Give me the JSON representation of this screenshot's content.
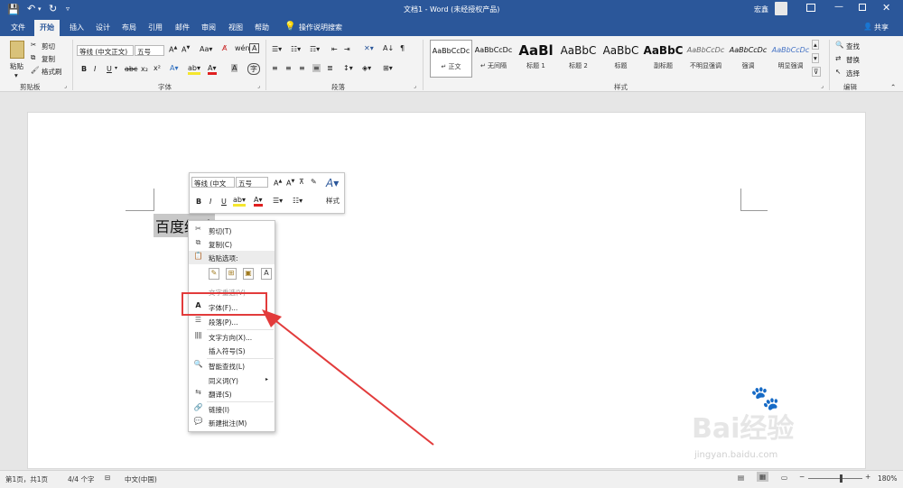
{
  "title_bar": {
    "title": "文档1 - Word (未经授权产品)",
    "user": "宏鑫"
  },
  "tabs": [
    "文件",
    "开始",
    "插入",
    "设计",
    "布局",
    "引用",
    "邮件",
    "审阅",
    "视图",
    "帮助"
  ],
  "tell_me": "操作说明搜索",
  "share": "共享",
  "clipboard": {
    "paste": "粘贴",
    "cut": "剪切",
    "copy": "复制",
    "format_painter": "格式刷",
    "group": "剪贴板"
  },
  "font_group": {
    "font_name": "等线 (中文正文)",
    "font_size": "五号",
    "group": "字体"
  },
  "paragraph_group": {
    "group": "段落"
  },
  "styles": {
    "group": "样式",
    "items": [
      {
        "preview": "AaBbCcDc",
        "label": "↵ 正文"
      },
      {
        "preview": "AaBbCcDc",
        "label": "↵ 无间隔"
      },
      {
        "preview": "AaBl",
        "label": "标题 1"
      },
      {
        "preview": "AaBbC",
        "label": "标题 2"
      },
      {
        "preview": "AaBbC",
        "label": "标题"
      },
      {
        "preview": "AaBbC",
        "label": "副标题"
      },
      {
        "preview": "AaBbCcDc",
        "label": "不明显强调"
      },
      {
        "preview": "AaBbCcDc",
        "label": "强调"
      },
      {
        "preview": "AaBbCcDc",
        "label": "明显强调"
      }
    ]
  },
  "editing": {
    "find": "查找",
    "replace": "替换",
    "select": "选择",
    "group": "编辑"
  },
  "mini_toolbar": {
    "font": "等线 (中文",
    "size": "五号",
    "styles": "样式"
  },
  "doc_text": "百度经验",
  "context_menu": {
    "cut": "剪切(T)",
    "copy": "复制(C)",
    "paste_options": "粘贴选项:",
    "reconvert": "文字重选(V)",
    "font": "字体(F)...",
    "paragraph": "段落(P)...",
    "text_direction": "文字方向(X)...",
    "insert_symbol": "插入符号(S)",
    "smart_lookup": "智能查找(L)",
    "synonyms": "同义词(Y)",
    "translate": "翻译(S)",
    "link": "链接(I)",
    "new_comment": "新建批注(M)"
  },
  "status": {
    "page": "第1页，共1页",
    "words": "4/4 个字",
    "language": "中文(中国)",
    "zoom": "180%"
  },
  "watermark": {
    "brand": "Bai经验",
    "url": "jingyan.baidu.com"
  },
  "colors": {
    "word_blue": "#2b579a",
    "highlight_red": "#e23b3b"
  }
}
